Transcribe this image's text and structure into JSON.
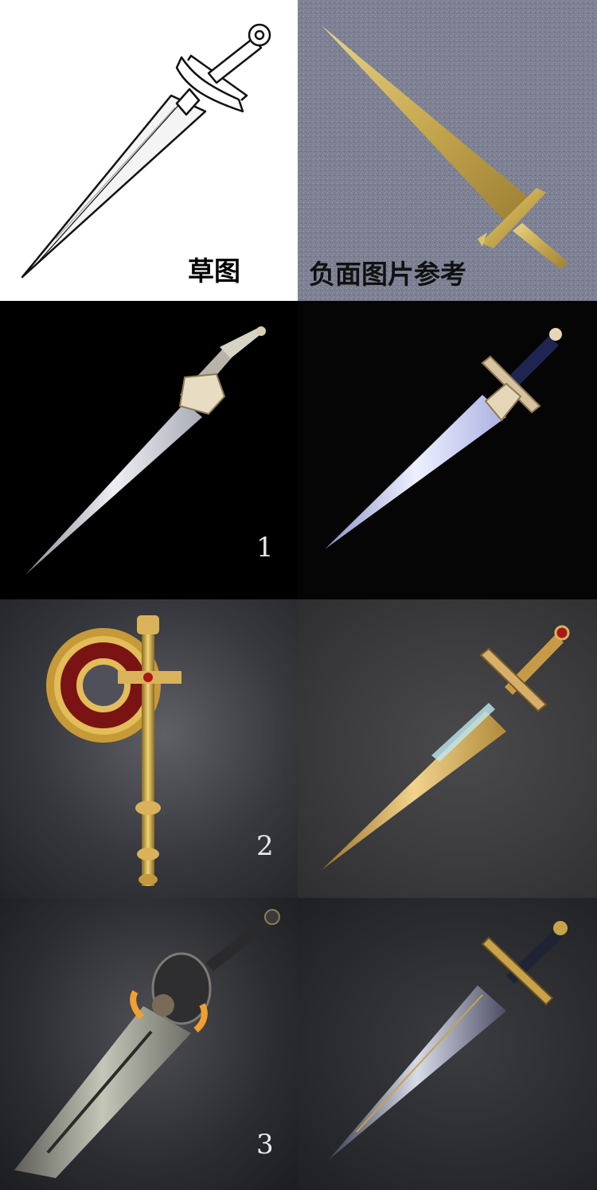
{
  "panels": [
    {
      "id": "sketch",
      "label": "草图"
    },
    {
      "id": "negative-reference",
      "label": "负面图片参考"
    },
    {
      "id": "variant-1",
      "label": "1"
    },
    {
      "id": "variant-1b",
      "label": ""
    },
    {
      "id": "variant-2",
      "label": "2"
    },
    {
      "id": "variant-2b",
      "label": ""
    },
    {
      "id": "variant-3",
      "label": "3"
    },
    {
      "id": "variant-3b",
      "label": ""
    }
  ],
  "colors": {
    "sketch_bg": "#ffffff",
    "negative_bg": "#7b7f90",
    "gold": "#c9a24a",
    "silver_blade": "#d9dbe6",
    "dark_bg": "#000000"
  }
}
